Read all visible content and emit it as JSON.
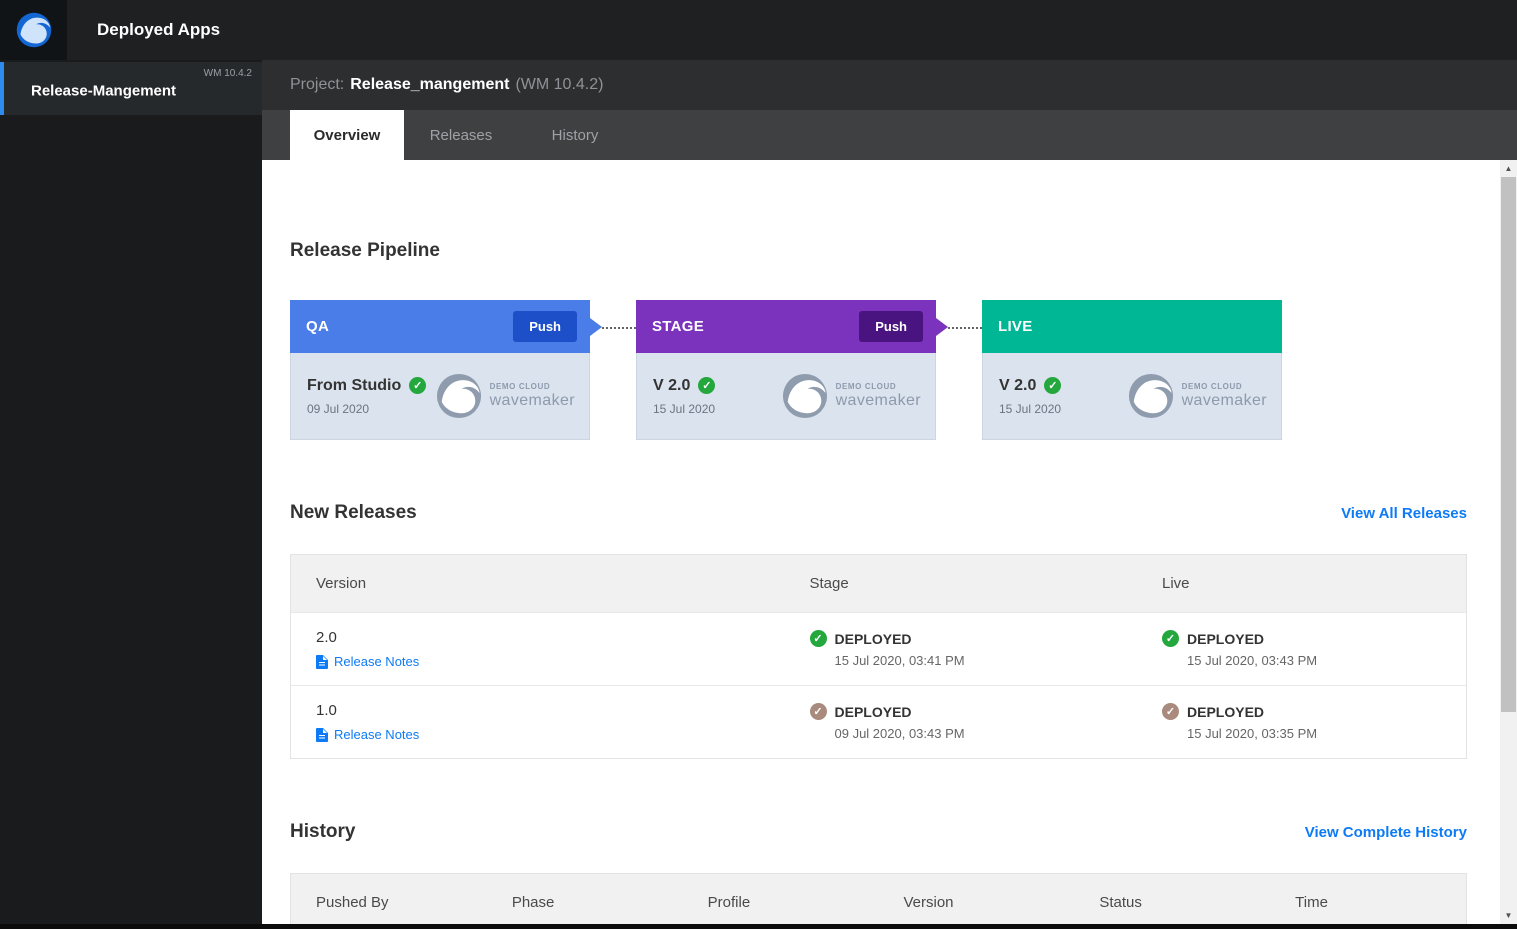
{
  "topbar": {
    "title": "Deployed Apps"
  },
  "sidebar": {
    "project": "Release-Mangement",
    "version": "WM 10.4.2"
  },
  "project_header": {
    "label": "Project:",
    "name": "Release_mangement",
    "version": "(WM 10.4.2)"
  },
  "tabs": [
    {
      "label": "Overview",
      "active": true
    },
    {
      "label": "Releases",
      "active": false
    },
    {
      "label": "History",
      "active": false
    }
  ],
  "icons": {
    "check": "✓",
    "scroll_up": "▲",
    "scroll_down": "▼"
  },
  "pipeline": {
    "heading": "Release Pipeline",
    "logo_line1": "DEMO CLOUD",
    "logo_line2": "wavemaker",
    "stages": [
      {
        "name": "QA",
        "push": "Push",
        "header_color": "#4a7de8",
        "push_color": "#1d4fc9",
        "version": "From Studio",
        "date": "09 Jul 2020",
        "check_color": "#24a73d"
      },
      {
        "name": "STAGE",
        "push": "Push",
        "header_color": "#7b33bd",
        "push_color": "#4a1480",
        "version": "V 2.0",
        "date": "15 Jul 2020",
        "check_color": "#24a73d"
      },
      {
        "name": "LIVE",
        "header_color": "#00b795",
        "version": "V 2.0",
        "date": "15 Jul 2020",
        "check_color": "#24a73d"
      }
    ]
  },
  "new_releases": {
    "heading": "New Releases",
    "view_all": "View All Releases",
    "release_notes_label": "Release Notes",
    "columns": [
      "Version",
      "Stage",
      "Live"
    ],
    "rows": [
      {
        "version": "2.0",
        "stage": {
          "status": "DEPLOYED",
          "time": "15 Jul 2020, 03:41 PM",
          "check_color": "#24a73d"
        },
        "live": {
          "status": "DEPLOYED",
          "time": "15 Jul 2020, 03:43 PM",
          "check_color": "#24a73d"
        }
      },
      {
        "version": "1.0",
        "stage": {
          "status": "DEPLOYED",
          "time": "09 Jul 2020, 03:43 PM",
          "check_color": "#a98a7d"
        },
        "live": {
          "status": "DEPLOYED",
          "time": "15 Jul 2020, 03:35 PM",
          "check_color": "#a98a7d"
        }
      }
    ]
  },
  "history": {
    "heading": "History",
    "view_all": "View Complete History",
    "columns": [
      "Pushed By",
      "Phase",
      "Profile",
      "Version",
      "Status",
      "Time"
    ]
  }
}
